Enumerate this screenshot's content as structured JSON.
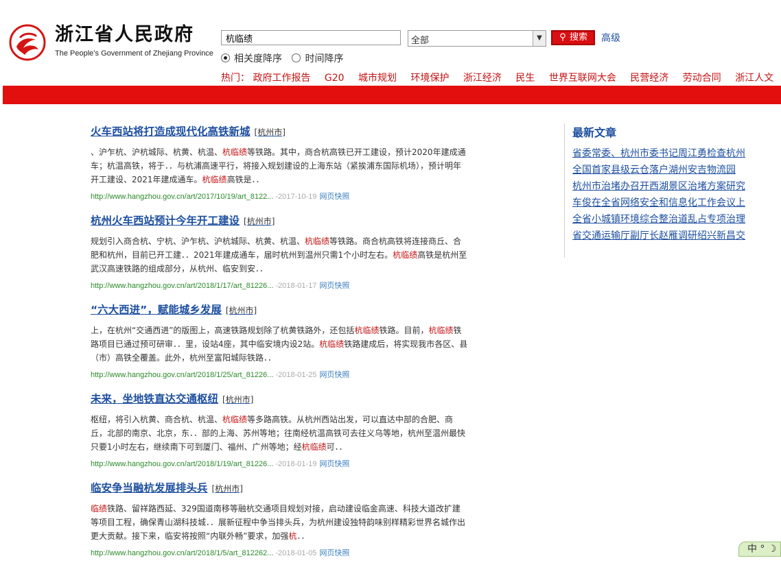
{
  "header": {
    "brand_cn": "浙江省人民政府",
    "brand_en": "The People’s Government of Zhejiang Province",
    "search_value": "杭临绩",
    "scope_value": "全部",
    "search_button": "搜索",
    "advanced_link": "高级",
    "sort": {
      "relevance": "相关度降序",
      "time": "时间降序"
    },
    "hot_label": "热门：",
    "hot_items": [
      "政府工作报告",
      "G20",
      "城市规划",
      "环境保护",
      "浙江经济",
      "民生",
      "世界互联网大会",
      "民营经济",
      "劳动合同",
      "浙江人文"
    ],
    "accent": "#e30f0f"
  },
  "results": [
    {
      "title": "火车西站将打造成现代化高铁新城",
      "region": "[杭州市]",
      "snippet_html": "、沪乍杭、沪杭城际、杭黄、杭温、<span class=\"hl\">杭临绩</span>等铁路。其中，商合杭高铁已开工建设，预计2020年建成通车；杭温高铁，将于．．与杭浦高速平行，将接入规划建设的上海东站（紧挨浦东国际机场），预计明年开工建设、2021年建成通车。<span class=\"hl\">杭临绩</span>高铁是．．",
      "url": "http://www.hangzhou.gov.cn/art/2017/10/19/art_8122...",
      "date": "-2017-10-19",
      "cache": "网页快照"
    },
    {
      "title": "杭州火车西站预计今年开工建设",
      "region": "[杭州市]",
      "snippet_html": "规划引入商合杭、宁杭、沪乍杭、沪杭城际、杭黄、杭温、<span class=\"hl\">杭临绩</span>等铁路。商合杭高铁将连接商丘、合肥和杭州，目前已开工建．．2021年建成通车，届时杭州到温州只需1个小时左右。<span class=\"hl\">杭临绩</span>高铁是杭州至武汉高速铁路的组成部分，从杭州、临安到安．．",
      "url": "http://www.hangzhou.gov.cn/art/2018/1/17/art_81226...",
      "date": "-2018-01-17",
      "cache": "网页快照"
    },
    {
      "title": "“六大西进”，赋能城乡发展",
      "region": "[杭州市]",
      "snippet_html": "上，在杭州“交通西进”的版图上，高速铁路规划除了杭黄铁路外，还包括<span class=\"hl\">杭临绩</span>铁路。目前，<span class=\"hl\">杭临绩</span>铁路项目已通过预可研审．．里，设站4座，其中临安境内设2站。<span class=\"hl\">杭临绩</span>铁路建成后，将实现我市各区、县（市）高铁全覆盖。此外，杭州至富阳城际铁路．．",
      "url": "http://www.hangzhou.gov.cn/art/2018/1/25/art_81226...",
      "date": "-2018-01-25",
      "cache": "网页快照"
    },
    {
      "title": "未来，坐地铁直达交通枢纽",
      "region": "[杭州市]",
      "snippet_html": "枢纽，将引入杭黄、商合杭、杭温、<span class=\"hl\">杭临绩</span>等多路高铁。从杭州西站出发，可以直达中部的合肥、商丘，北部的南京、北京，东．．部的上海、苏州等地；往南经杭温高铁可去往义乌等地，杭州至温州最快只要1小时左右，继续南下可到厦门、福州、广州等地；经<span class=\"hl\">杭临绩</span>可．．",
      "url": "http://www.hangzhou.gov.cn/art/2018/1/19/art_81226...",
      "date": "-2018-01-19",
      "cache": "网页快照"
    },
    {
      "title": "临安争当融杭发展排头兵",
      "region": "[杭州市]",
      "snippet_html": "<span class=\"hl\">临绩</span>铁路、留祥路西延、329国道南移等融杭交通项目规划对接，启动建设临金高速、科技大道改扩建等项目工程，确保青山湖科技城．．展新征程中争当排头兵，为杭州建设独特韵味别样精彩世界名城作出更大贡献。接下来，临安将按照“内联外畅”要求，加强<span class=\"hl\">杭</span>．．",
      "url": "http://www.hangzhou.gov.cn/art/2018/1/5/art_812262...",
      "date": "-2018-01-05",
      "cache": "网页快照"
    }
  ],
  "sidebar": {
    "title": "最新文章",
    "items": [
      "省委常委、杭州市委书记周江勇检查杭州",
      "全国首家县级云仓落户湖州安吉物流园",
      "杭州市治堵办召开西湖景区治堵方案研究",
      "车俊在全省网络安全和信息化工作会议上",
      "全省小城镇环境综合整治道乱占专项治理",
      "省交通运输厅副厅长赵雁调研绍兴新昌交"
    ]
  },
  "ime": {
    "label": "中"
  }
}
